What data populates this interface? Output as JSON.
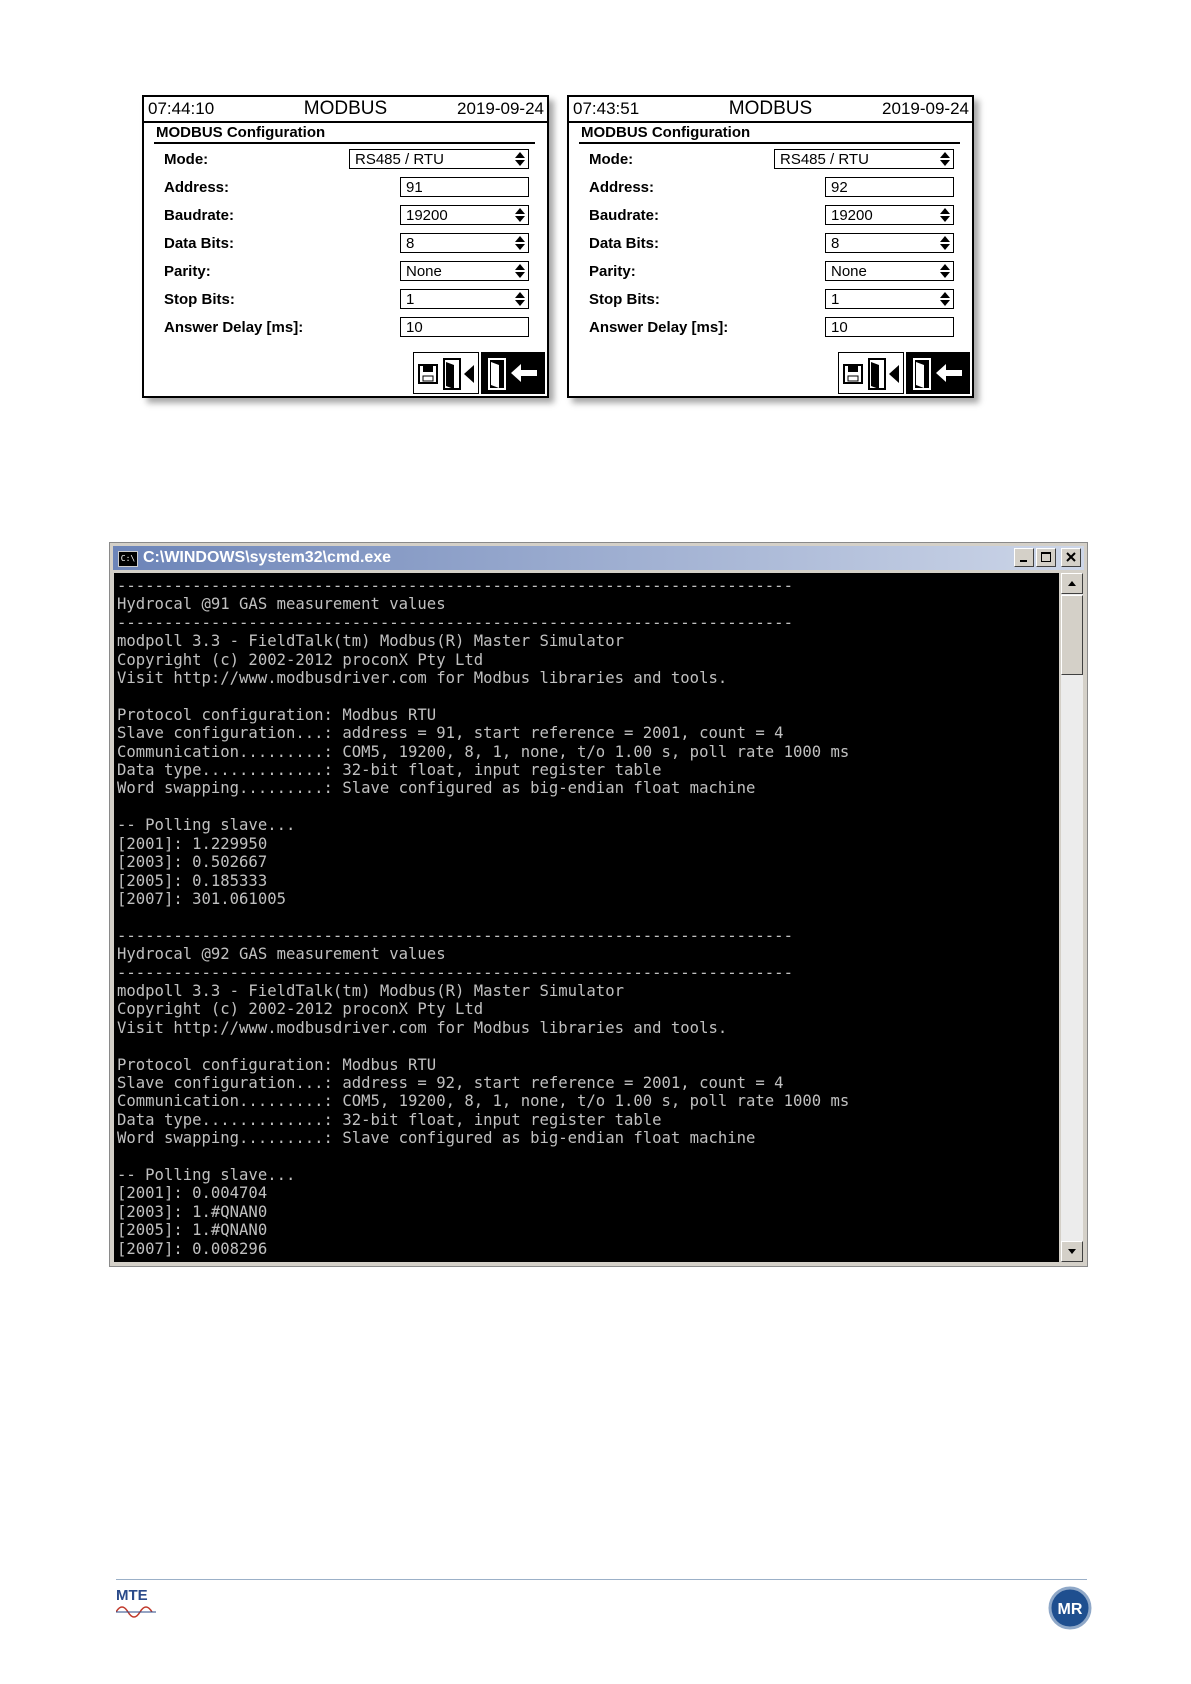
{
  "panels": [
    {
      "header": {
        "time": "07:44:10",
        "title": "MODBUS",
        "date": "2019-09-24"
      },
      "section_title": "MODBUS Configuration",
      "rows": [
        {
          "label": "Mode:",
          "value": "RS485 / RTU"
        },
        {
          "label": "Address:",
          "value": "91"
        },
        {
          "label": "Baudrate:",
          "value": "19200"
        },
        {
          "label": "Data Bits:",
          "value": "8"
        },
        {
          "label": "Parity:",
          "value": "None"
        },
        {
          "label": "Stop Bits:",
          "value": "1"
        },
        {
          "label": "Answer Delay [ms]:",
          "value": "10"
        }
      ]
    },
    {
      "header": {
        "time": "07:43:51",
        "title": "MODBUS",
        "date": "2019-09-24"
      },
      "section_title": "MODBUS Configuration",
      "rows": [
        {
          "label": "Mode:",
          "value": "RS485 / RTU"
        },
        {
          "label": "Address:",
          "value": "92"
        },
        {
          "label": "Baudrate:",
          "value": "19200"
        },
        {
          "label": "Data Bits:",
          "value": "8"
        },
        {
          "label": "Parity:",
          "value": "None"
        },
        {
          "label": "Stop Bits:",
          "value": "1"
        },
        {
          "label": "Answer Delay [ms]:",
          "value": "10"
        }
      ]
    }
  ],
  "cmd": {
    "title": "C:\\WINDOWS\\system32\\cmd.exe",
    "icon_text": "C:\\",
    "lines": [
      "------------------------------------------------------------------------",
      "Hydrocal @91 GAS measurement values",
      "------------------------------------------------------------------------",
      "modpoll 3.3 - FieldTalk(tm) Modbus(R) Master Simulator",
      "Copyright (c) 2002-2012 proconX Pty Ltd",
      "Visit http://www.modbusdriver.com for Modbus libraries and tools.",
      "",
      "Protocol configuration: Modbus RTU",
      "Slave configuration...: address = 91, start reference = 2001, count = 4",
      "Communication.........: COM5, 19200, 8, 1, none, t/o 1.00 s, poll rate 1000 ms",
      "Data type.............: 32-bit float, input register table",
      "Word swapping.........: Slave configured as big-endian float machine",
      "",
      "-- Polling slave...",
      "[2001]: 1.229950",
      "[2003]: 0.502667",
      "[2005]: 0.185333",
      "[2007]: 301.061005",
      "",
      "------------------------------------------------------------------------",
      "Hydrocal @92 GAS measurement values",
      "------------------------------------------------------------------------",
      "modpoll 3.3 - FieldTalk(tm) Modbus(R) Master Simulator",
      "Copyright (c) 2002-2012 proconX Pty Ltd",
      "Visit http://www.modbusdriver.com for Modbus libraries and tools.",
      "",
      "Protocol configuration: Modbus RTU",
      "Slave configuration...: address = 92, start reference = 2001, count = 4",
      "Communication.........: COM5, 19200, 8, 1, none, t/o 1.00 s, poll rate 1000 ms",
      "Data type.............: 32-bit float, input register table",
      "Word swapping.........: Slave configured as big-endian float machine",
      "",
      "-- Polling slave...",
      "[2001]: 0.004704",
      "[2003]: 1.#QNAN0",
      "[2005]: 1.#QNAN0",
      "[2007]: 0.008296"
    ]
  },
  "footer": {
    "logo_left": "MTE",
    "logo_right": "MR"
  },
  "colors": {
    "console_bg": "#000000",
    "console_fg": "#c0c0c0",
    "titlebar": "#6c84b8"
  }
}
